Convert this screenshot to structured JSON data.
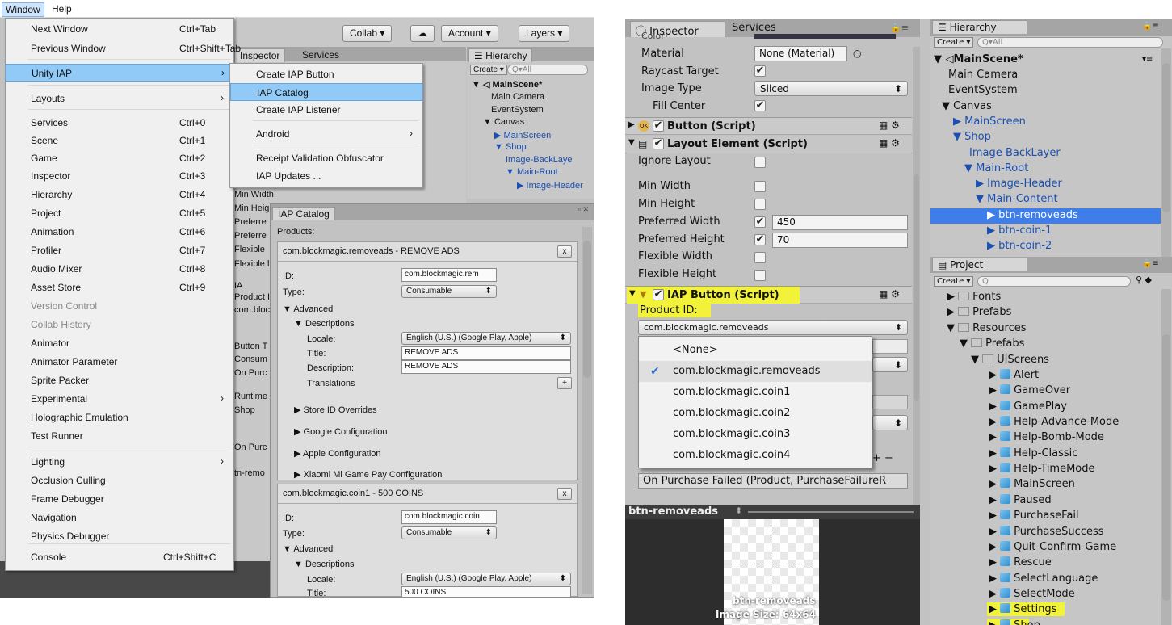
{
  "menubar": {
    "window": "Window",
    "help": "Help"
  },
  "toolbar": {
    "collab": "Collab ▾",
    "cloud": "☁",
    "account": "Account ▾",
    "layers": "Layers ▾"
  },
  "left_tabs": {
    "inspector": "Inspector",
    "services": "Services",
    "hierarchy": "Hierarchy"
  },
  "left_hier": {
    "create": "Create ▾",
    "search": "Q▾All",
    "scene": "MainScene*",
    "items": [
      "Main Camera",
      "EventSystem",
      "▼ Canvas",
      "▶ MainScreen",
      "▼ Shop",
      "Image-BackLaye",
      "▼ Main-Root",
      "▶ Image-Header"
    ]
  },
  "left_insp_bits": [
    "Min Width",
    "Min Heig",
    "Preferre",
    "Preferre",
    "Flexible ",
    "Flexible l",
    "IA",
    "Product I",
    "com.bloc",
    "Button T",
    "Consum",
    "On Purc",
    "Runtime",
    "Shop",
    "On Purc",
    "tn-remo"
  ],
  "window_menu": [
    {
      "label": "Next Window",
      "shortcut": "Ctrl+Tab"
    },
    {
      "label": "Previous Window",
      "shortcut": "Ctrl+Shift+Tab"
    },
    {
      "label": "Unity IAP",
      "arrow": "›"
    },
    {
      "label": "Layouts",
      "arrow": "›"
    },
    {
      "label": "Services",
      "shortcut": "Ctrl+0"
    },
    {
      "label": "Scene",
      "shortcut": "Ctrl+1"
    },
    {
      "label": "Game",
      "shortcut": "Ctrl+2"
    },
    {
      "label": "Inspector",
      "shortcut": "Ctrl+3"
    },
    {
      "label": "Hierarchy",
      "shortcut": "Ctrl+4"
    },
    {
      "label": "Project",
      "shortcut": "Ctrl+5"
    },
    {
      "label": "Animation",
      "shortcut": "Ctrl+6"
    },
    {
      "label": "Profiler",
      "shortcut": "Ctrl+7"
    },
    {
      "label": "Audio Mixer",
      "shortcut": "Ctrl+8"
    },
    {
      "label": "Asset Store",
      "shortcut": "Ctrl+9"
    },
    {
      "label": "Version Control"
    },
    {
      "label": "Collab History"
    },
    {
      "label": "Animator"
    },
    {
      "label": "Animator Parameter"
    },
    {
      "label": "Sprite Packer"
    },
    {
      "label": "Experimental",
      "arrow": "›"
    },
    {
      "label": "Holographic Emulation"
    },
    {
      "label": "Test Runner"
    },
    {
      "label": "Lighting",
      "arrow": "›"
    },
    {
      "label": "Occlusion Culling"
    },
    {
      "label": "Frame Debugger"
    },
    {
      "label": "Navigation"
    },
    {
      "label": "Physics Debugger"
    },
    {
      "label": "Console",
      "shortcut": "Ctrl+Shift+C"
    }
  ],
  "iap_submenu": [
    {
      "label": "Create IAP Button"
    },
    {
      "label": "IAP Catalog"
    },
    {
      "label": "Create IAP Listener"
    },
    {
      "label": "Android",
      "arrow": "›"
    },
    {
      "label": "Receipt Validation Obfuscator"
    },
    {
      "label": "IAP Updates ..."
    }
  ],
  "catalog": {
    "tab": "IAP Catalog",
    "products_label": "Products:",
    "product1": {
      "header": "com.blockmagic.removeads - REMOVE ADS",
      "id_label": "ID:",
      "id": "com.blockmagic.rem",
      "type_label": "Type:",
      "type": "Consumable",
      "advanced": "▼ Advanced",
      "descriptions": "▼ Descriptions",
      "locale_label": "Locale:",
      "locale": "English (U.S.) (Google Play, Apple)",
      "title_label": "Title:",
      "title": "REMOVE ADS",
      "desc_label": "Description:",
      "desc": "REMOVE ADS",
      "translations": "Translations",
      "store_overrides": "▶ Store ID Overrides",
      "google": "▶ Google Configuration",
      "apple": "▶ Apple Configuration",
      "xiaomi": "▶ Xiaomi Mi Game Pay Configuration"
    },
    "product2": {
      "header": "com.blockmagic.coin1 - 500 COINS",
      "id_label": "ID:",
      "id": "com.blockmagic.coin",
      "type_label": "Type:",
      "type": "Consumable",
      "advanced": "▼ Advanced",
      "descriptions": "▼ Descriptions",
      "locale_label": "Locale:",
      "locale": "English (U.S.) (Google Play, Apple)",
      "title_label": "Title:",
      "title": "500 COINS"
    }
  },
  "right_tabs": {
    "inspector": "Inspector",
    "services": "Services",
    "hierarchy": "Hierarchy",
    "project": "Project"
  },
  "right_insp": {
    "color_label": "Color",
    "material_label": "Material",
    "material": "None (Material)",
    "raycast_label": "Raycast Target",
    "image_type_label": "Image Type",
    "image_type": "Sliced",
    "fill_center_label": "Fill Center",
    "button_comp": "Button (Script)",
    "layout_comp": "Layout Element (Script)",
    "ignore_layout": "Ignore Layout",
    "min_width": "Min Width",
    "min_height": "Min Height",
    "pref_width": "Preferred Width",
    "pref_width_val": "450",
    "pref_height": "Preferred Height",
    "pref_height_val": "70",
    "flex_width": "Flexible Width",
    "flex_height": "Flexible Height",
    "iap_comp": "IAP Button (Script)",
    "product_id_label": "Product ID:",
    "product_id": "com.blockmagic.removeads",
    "purchase_failed": "On Purchase Failed (Product, PurchaseFailureR"
  },
  "product_dropdown": [
    "<None>",
    "com.blockmagic.removeads",
    "com.blockmagic.coin1",
    "com.blockmagic.coin2",
    "com.blockmagic.coin3",
    "com.blockmagic.coin4"
  ],
  "preview": {
    "name": "btn-removeads",
    "caption1": "btn-removeads",
    "caption2": "Image Size: 64x64"
  },
  "right_hier": {
    "create": "Create ▾",
    "search": "Q▾All",
    "scene": "MainScene*",
    "items": [
      "Main Camera",
      "EventSystem",
      "▼ Canvas",
      "▶ MainScreen",
      "▼ Shop",
      "Image-BackLayer",
      "▼ Main-Root",
      "▶ Image-Header",
      "▼ Main-Content",
      "▶ btn-removeads",
      "▶ btn-coin-1",
      "▶ btn-coin-2"
    ]
  },
  "project": {
    "create": "Create ▾",
    "search": "Q",
    "folders": [
      "Fonts",
      "Prefabs",
      "Resources",
      "Prefabs",
      "UIScreens"
    ],
    "screens": [
      "Alert",
      "GameOver",
      "GamePlay",
      "Help-Advance-Mode",
      "Help-Bomb-Mode",
      "Help-Classic",
      "Help-TimeMode",
      "MainScreen",
      "Paused",
      "PurchaseFail",
      "PurchaseSuccess",
      "Quit-Confirm-Game",
      "Rescue",
      "SelectLanguage",
      "SelectMode",
      "Settings",
      "Shop"
    ]
  },
  "colors": {
    "menu_highlight": "#91c9f7",
    "selection": "#3f7de8",
    "annotation": "#f2f23a"
  }
}
